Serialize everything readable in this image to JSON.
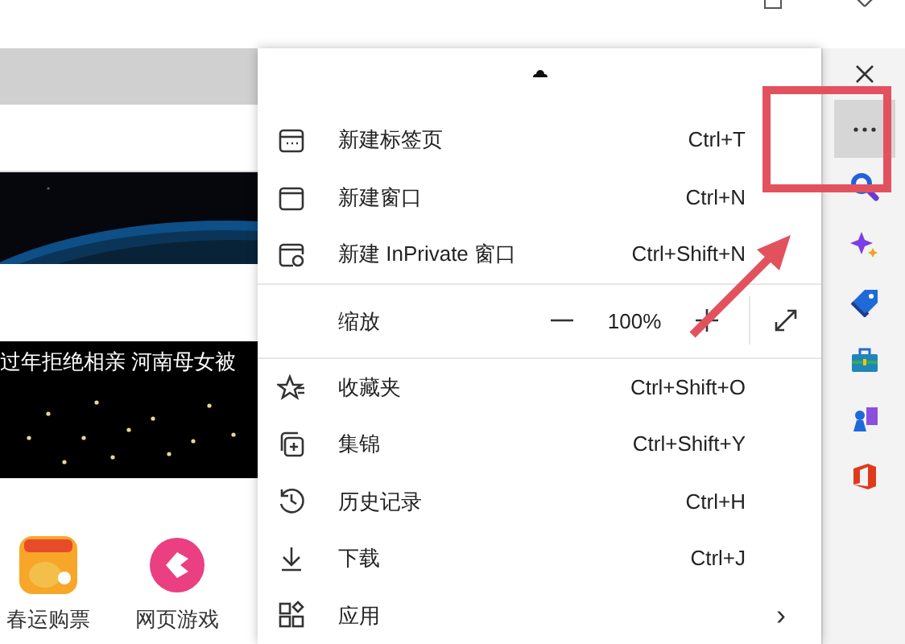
{
  "page": {
    "news_headline": "过年拒绝相亲 河南母女被",
    "shortcuts": [
      {
        "label": "春运购票"
      },
      {
        "label": "网页游戏"
      }
    ]
  },
  "menu": {
    "items": [
      {
        "kind": "item",
        "label": "新建标签页",
        "shortcut": "Ctrl+T"
      },
      {
        "kind": "item",
        "label": "新建窗口",
        "shortcut": "Ctrl+N"
      },
      {
        "kind": "item",
        "label": "新建 InPrivate 窗口",
        "shortcut": "Ctrl+Shift+N"
      },
      {
        "kind": "zoom",
        "label": "缩放",
        "value": "100%"
      },
      {
        "kind": "item",
        "label": "收藏夹",
        "shortcut": "Ctrl+Shift+O"
      },
      {
        "kind": "item",
        "label": "集锦",
        "shortcut": "Ctrl+Shift+Y"
      },
      {
        "kind": "item",
        "label": "历史记录",
        "shortcut": "Ctrl+H"
      },
      {
        "kind": "item",
        "label": "下载",
        "shortcut": "Ctrl+J"
      },
      {
        "kind": "submenu",
        "label": "应用",
        "arrow": "›"
      }
    ]
  },
  "sidebar": {
    "items": [
      {
        "kind": "close",
        "selected": false
      },
      {
        "kind": "more",
        "selected": true
      },
      {
        "kind": "search",
        "selected": false
      },
      {
        "kind": "sparkle",
        "selected": false
      },
      {
        "kind": "tag",
        "selected": false
      },
      {
        "kind": "toolbox",
        "selected": false
      },
      {
        "kind": "chess",
        "selected": false
      },
      {
        "kind": "office",
        "selected": false
      }
    ]
  }
}
